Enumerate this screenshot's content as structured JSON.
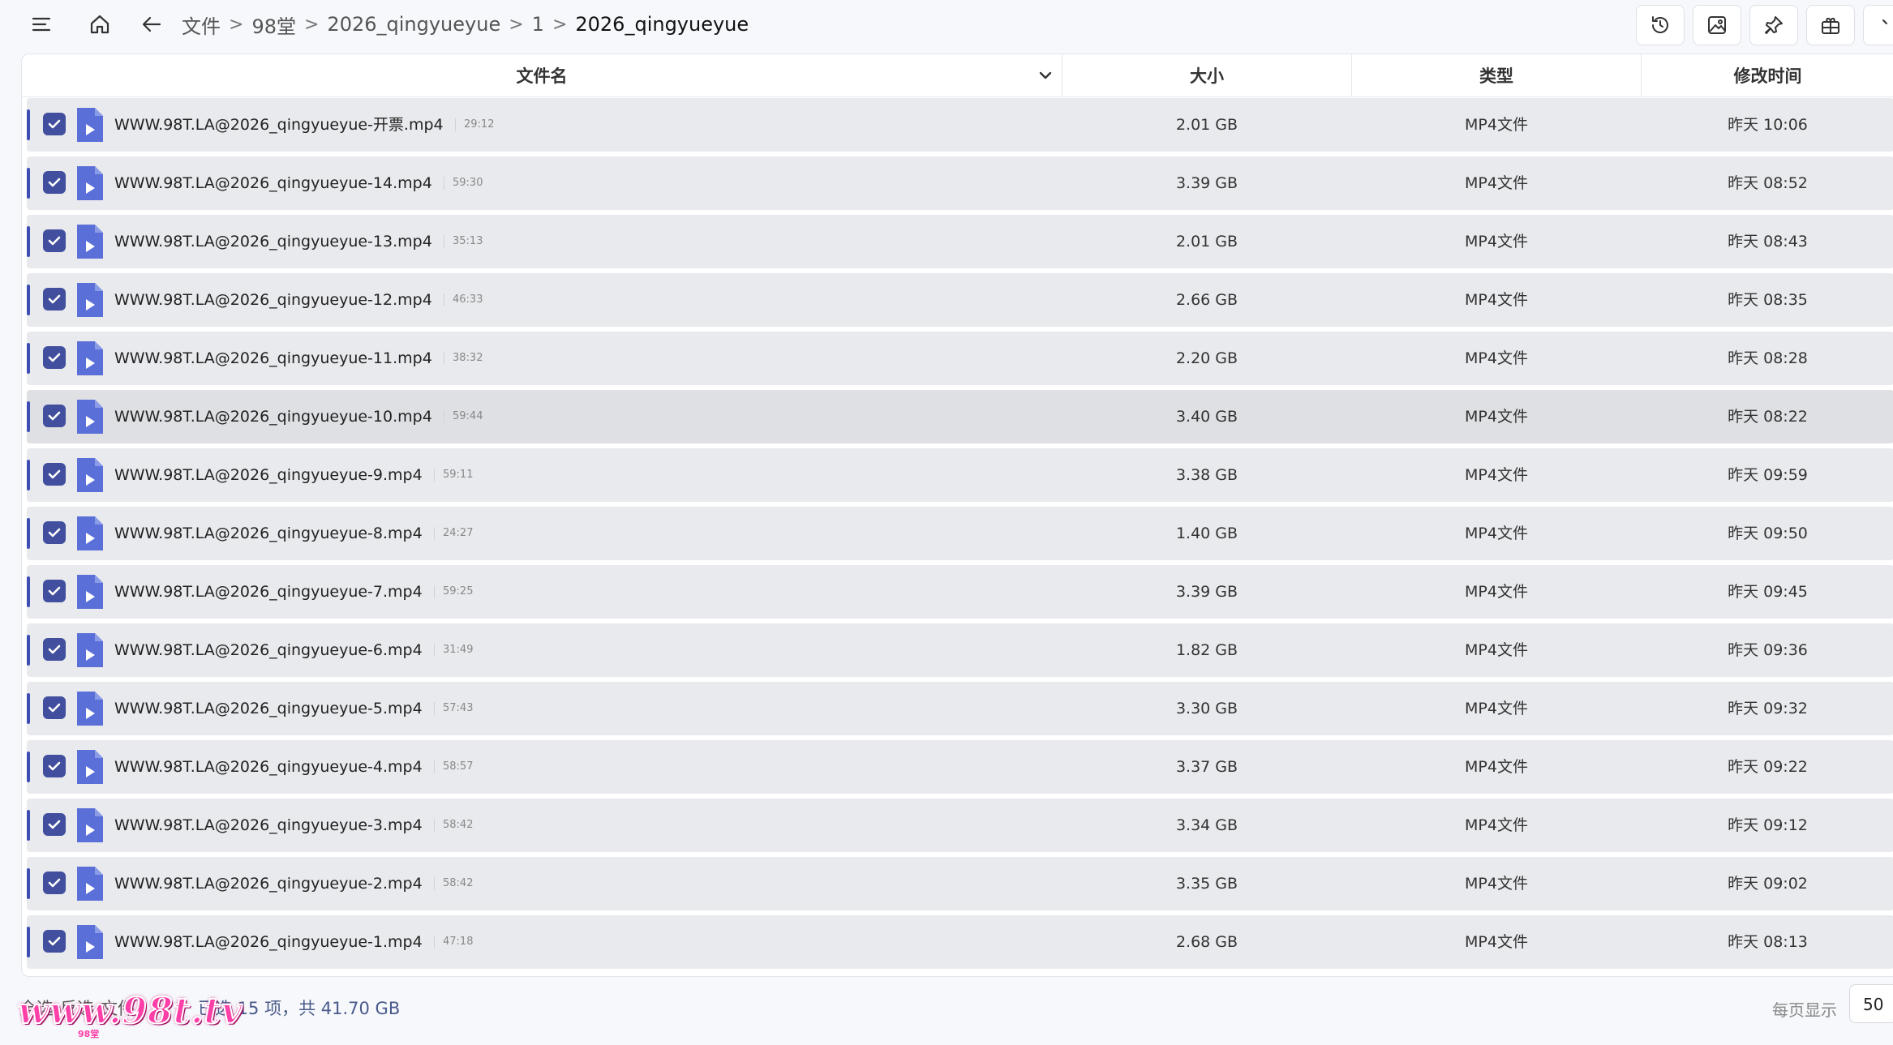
{
  "breadcrumbs": [
    "文件",
    "98堂",
    "2026_qingyueyue",
    "1",
    "2026_qingyueyue"
  ],
  "columns": {
    "name": "文件名",
    "size": "大小",
    "type": "类型",
    "time": "修改时间"
  },
  "icons": {
    "menu": "hamburger-icon",
    "home": "home-icon",
    "back": "arrow-left-icon",
    "toolbar": [
      "history-icon",
      "image-icon",
      "pin-icon",
      "grid-icon"
    ]
  },
  "accent_color": "#414f9e",
  "file_icon_color": "#5b6fd8",
  "files": [
    {
      "name": "WWW.98T.LA@2026_qingyueyue-开票.mp4",
      "duration": "29:12",
      "size": "2.01 GB",
      "type": "MP4文件",
      "time": "昨天 10:06"
    },
    {
      "name": "WWW.98T.LA@2026_qingyueyue-14.mp4",
      "duration": "59:30",
      "size": "3.39 GB",
      "type": "MP4文件",
      "time": "昨天 08:52"
    },
    {
      "name": "WWW.98T.LA@2026_qingyueyue-13.mp4",
      "duration": "35:13",
      "size": "2.01 GB",
      "type": "MP4文件",
      "time": "昨天 08:43"
    },
    {
      "name": "WWW.98T.LA@2026_qingyueyue-12.mp4",
      "duration": "46:33",
      "size": "2.66 GB",
      "type": "MP4文件",
      "time": "昨天 08:35"
    },
    {
      "name": "WWW.98T.LA@2026_qingyueyue-11.mp4",
      "duration": "38:32",
      "size": "2.20 GB",
      "type": "MP4文件",
      "time": "昨天 08:28"
    },
    {
      "name": "WWW.98T.LA@2026_qingyueyue-10.mp4",
      "duration": "59:44",
      "size": "3.40 GB",
      "type": "MP4文件",
      "time": "昨天 08:22"
    },
    {
      "name": "WWW.98T.LA@2026_qingyueyue-9.mp4",
      "duration": "59:11",
      "size": "3.38 GB",
      "type": "MP4文件",
      "time": "昨天 09:59"
    },
    {
      "name": "WWW.98T.LA@2026_qingyueyue-8.mp4",
      "duration": "24:27",
      "size": "1.40 GB",
      "type": "MP4文件",
      "time": "昨天 09:50"
    },
    {
      "name": "WWW.98T.LA@2026_qingyueyue-7.mp4",
      "duration": "59:25",
      "size": "3.39 GB",
      "type": "MP4文件",
      "time": "昨天 09:45"
    },
    {
      "name": "WWW.98T.LA@2026_qingyueyue-6.mp4",
      "duration": "31:49",
      "size": "1.82 GB",
      "type": "MP4文件",
      "time": "昨天 09:36"
    },
    {
      "name": "WWW.98T.LA@2026_qingyueyue-5.mp4",
      "duration": "57:43",
      "size": "3.30 GB",
      "type": "MP4文件",
      "time": "昨天 09:32"
    },
    {
      "name": "WWW.98T.LA@2026_qingyueyue-4.mp4",
      "duration": "58:57",
      "size": "3.37 GB",
      "type": "MP4文件",
      "time": "昨天 09:22"
    },
    {
      "name": "WWW.98T.LA@2026_qingyueyue-3.mp4",
      "duration": "58:42",
      "size": "3.34 GB",
      "type": "MP4文件",
      "time": "昨天 09:12"
    },
    {
      "name": "WWW.98T.LA@2026_qingyueyue-2.mp4",
      "duration": "58:42",
      "size": "3.35 GB",
      "type": "MP4文件",
      "time": "昨天 09:02"
    },
    {
      "name": "WWW.98T.LA@2026_qingyueyue-1.mp4",
      "duration": "47:18",
      "size": "2.68 GB",
      "type": "MP4文件",
      "time": "昨天 08:13"
    }
  ],
  "footer": {
    "select_all": "全选",
    "invert": "反选",
    "file": "文件",
    "summary": "已选 15 项，共 41.70 GB",
    "per_page_label": "每页显示",
    "per_page_value": "50"
  },
  "watermark": {
    "text": "www.98t.tv",
    "sub": "98堂"
  }
}
